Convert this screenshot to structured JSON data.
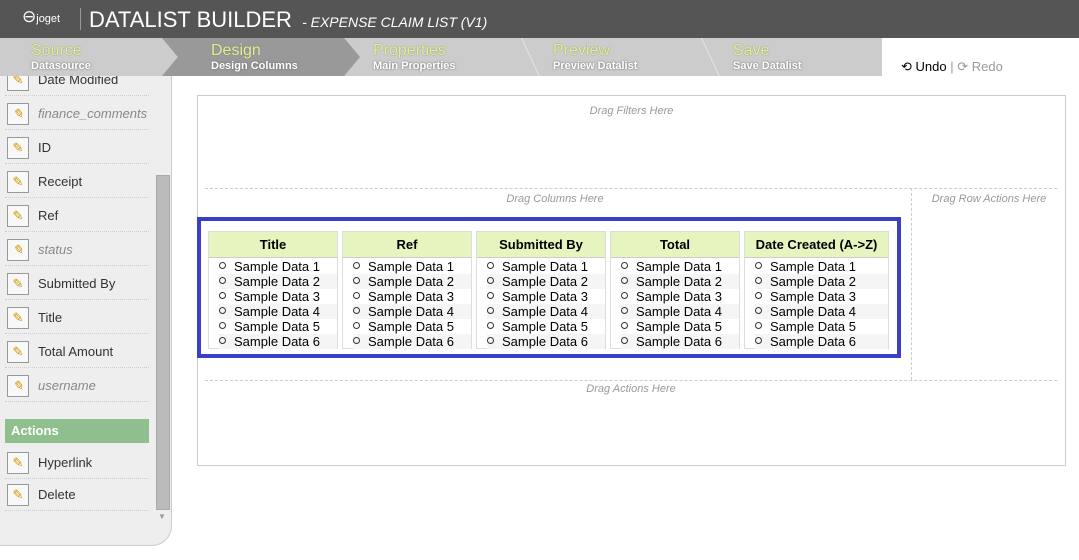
{
  "header": {
    "logo": "joget",
    "title": "DATALIST BUILDER",
    "subtitle": "- EXPENSE CLAIM LIST (V1)"
  },
  "steps": [
    {
      "label": "Source",
      "sub": "Datasource"
    },
    {
      "label": "Design",
      "sub": "Design Columns",
      "active": true
    },
    {
      "label": "Properties",
      "sub": "Main Properties"
    },
    {
      "label": "Preview",
      "sub": "Preview Datalist"
    },
    {
      "label": "Save",
      "sub": "Save Datalist"
    }
  ],
  "toolbar": {
    "undo": "Undo",
    "sep": "|",
    "redo": "Redo"
  },
  "sidebar": {
    "columns": [
      {
        "label": "Date Modified",
        "italic": false
      },
      {
        "label": "finance_comments",
        "italic": true
      },
      {
        "label": "ID",
        "italic": false
      },
      {
        "label": "Receipt",
        "italic": false
      },
      {
        "label": "Ref",
        "italic": false
      },
      {
        "label": "status",
        "italic": true
      },
      {
        "label": "Submitted By",
        "italic": false
      },
      {
        "label": "Title",
        "italic": false
      },
      {
        "label": "Total Amount",
        "italic": false
      },
      {
        "label": "username",
        "italic": true
      }
    ],
    "actions_header": "Actions",
    "actions": [
      "Hyperlink",
      "Delete"
    ]
  },
  "canvas": {
    "filters": "Drag Filters Here",
    "columns_hint": "Drag Columns Here",
    "row_actions": "Drag Row Actions Here",
    "actions": "Drag Actions Here",
    "columns": [
      "Title",
      "Ref",
      "Submitted By",
      "Total",
      "Date Created (A->Z)"
    ],
    "sample": [
      "Sample Data 1",
      "Sample Data 2",
      "Sample Data 3",
      "Sample Data 4",
      "Sample Data 5",
      "Sample Data 6"
    ]
  },
  "colors": {
    "selection": "#3a3fc9",
    "header_green": "#e6f5c0",
    "actions_bar": "#8fbf8f"
  }
}
